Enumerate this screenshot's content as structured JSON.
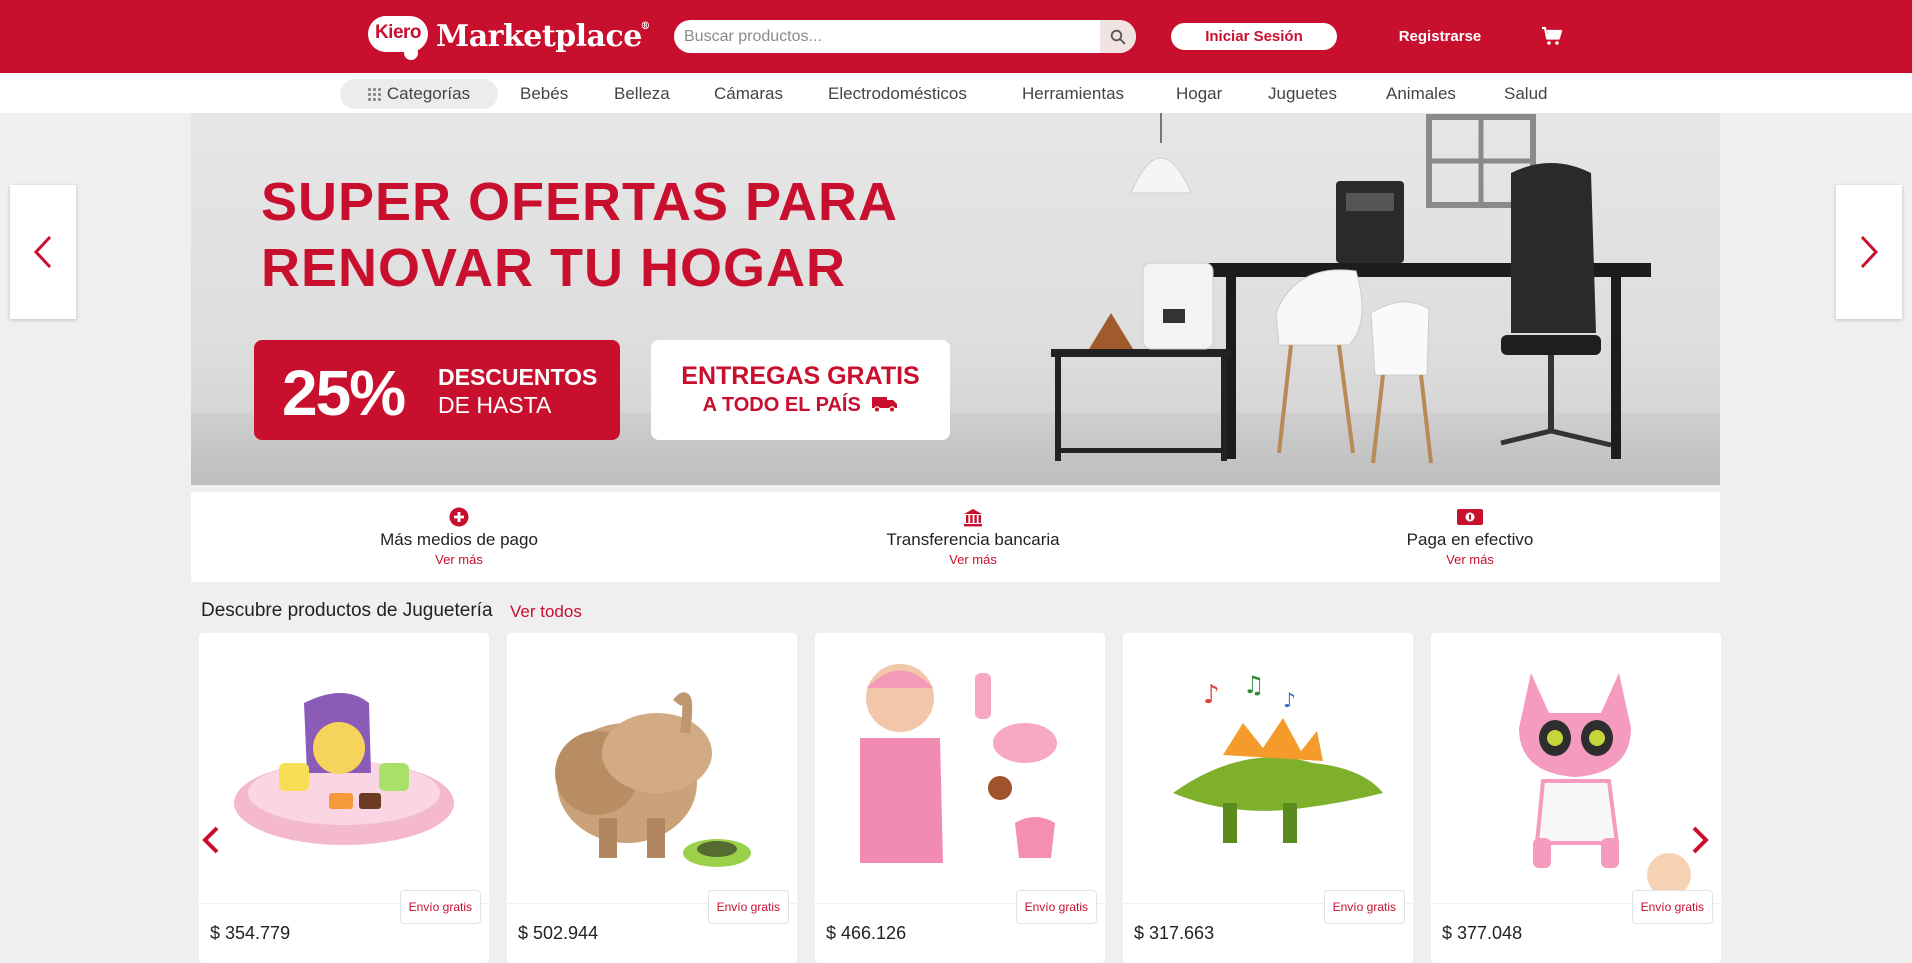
{
  "header": {
    "logo_badge": "Kiero",
    "logo_text": "Marketplace",
    "logo_reg": "®",
    "search_placeholder": "Buscar productos...",
    "login_label": "Iniciar Sesión",
    "register_label": "Registrarse",
    "brand_color": "#c8102e"
  },
  "nav": {
    "categories_label": "Categorías",
    "links": [
      "Bebés",
      "Belleza",
      "Cámaras",
      "Electrodomésticos",
      "Herramientas",
      "Hogar",
      "Juguetes",
      "Animales",
      "Salud"
    ]
  },
  "hero": {
    "title_line1": "SUPER OFERTAS PARA",
    "title_line2": "RENOVAR TU HOGAR",
    "discount_pct": "25%",
    "discount_line1": "DESCUENTOS",
    "discount_line2": "DE HASTA",
    "shipping_line1": "ENTREGAS GRATIS",
    "shipping_line2": "A TODO EL PAÍS"
  },
  "payments": [
    {
      "title": "Más medios de pago",
      "more": "Ver más",
      "icon": "plus-circle-icon"
    },
    {
      "title": "Transferencia bancaria",
      "more": "Ver más",
      "icon": "bank-icon"
    },
    {
      "title": "Paga en efectivo",
      "more": "Ver más",
      "icon": "cash-icon"
    }
  ],
  "products_section": {
    "title": "Descubre productos de Juguetería",
    "see_all": "Ver todos",
    "items": [
      {
        "price": "$ 354.779",
        "shipping": "Envío gratis",
        "image": "toy-tea-set"
      },
      {
        "price": "$ 502.944",
        "shipping": "Envío gratis",
        "image": "plush-dog"
      },
      {
        "price": "$ 466.126",
        "shipping": "Envío gratis",
        "image": "baby-doll-set"
      },
      {
        "price": "$ 317.663",
        "shipping": "Envío gratis",
        "image": "dinosaur-toy"
      },
      {
        "price": "$ 377.048",
        "shipping": "Envío gratis",
        "image": "robot-cat"
      }
    ]
  }
}
